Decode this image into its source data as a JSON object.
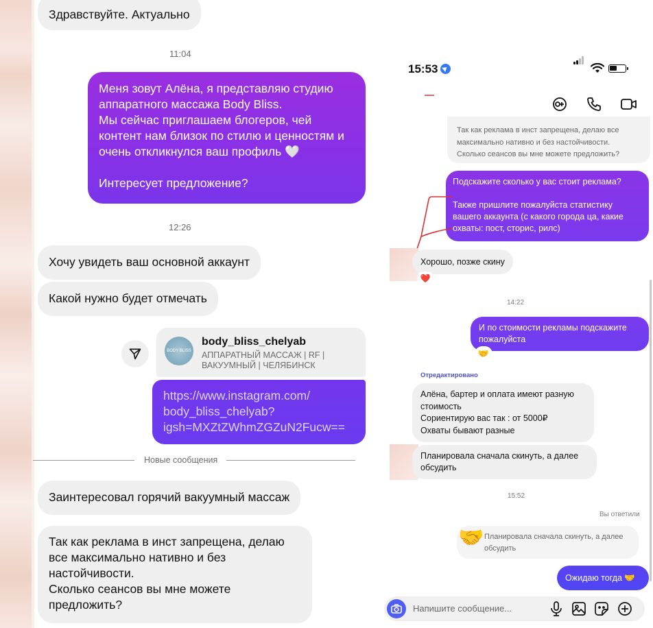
{
  "left": {
    "messages": [
      {
        "id": "m1",
        "direction": "in",
        "text": "Здравствуйте. Актуально"
      },
      {
        "id": "t1",
        "type": "time",
        "text": "11:04"
      },
      {
        "id": "m2",
        "direction": "out",
        "text": "Меня зовут Алёна, я представляю студию аппаратного массажа Body Bliss.\nМы сейчас приглашаем блогеров, чей контент нам близок по стилю и ценностям и очень откликнулся ваш профиль 🤍\n\nИнтересует предложение?"
      },
      {
        "id": "t2",
        "type": "time",
        "text": "12:26"
      },
      {
        "id": "m3",
        "direction": "in",
        "text": "Хочу увидеть ваш основной аккаунт"
      },
      {
        "id": "m4",
        "direction": "in",
        "text": "Какой нужно будет отмечать"
      },
      {
        "id": "m5",
        "direction": "in",
        "text": "Заинтересовал горячий вакуумный массаж"
      },
      {
        "id": "m6",
        "direction": "in",
        "text": "Так как реклама в инст запрещена, делаю все максимально нативно и без настойчивости.\nСколько сеансов вы мне можете предложить?"
      }
    ],
    "shared_profile": {
      "username": "body_bliss_chelyab",
      "description": "АППАРАТНЫЙ МАССАЖ | RF | ВАКУУМНЫЙ | ЧЕЛЯБИНСК",
      "avatar_text": "BODY BLISS"
    },
    "link_message": "https://www.instagram.com/\nbody_bliss_chelyab?\nigsh=MXZtZWhmZGZuN2Fucw==",
    "divider": "Новые сообщения"
  },
  "right": {
    "status_bar": {
      "time": "15:53"
    },
    "header_icons": [
      "video-chat-icon",
      "phone-icon",
      "video-camera-icon"
    ],
    "top_cut_message": "Так как реклама в инст запрещена, делаю все\nмаксимально нативно и без настойчивости.\nСколько сеансов вы мне можете предложить?",
    "msg_ask_price": "Подскажите сколько у вас стоит реклама?\n\nТакже пришлите пожалуйста статистику вашего аккаунта (с какого города ца, какие охваты: пост, сторис, рилс)",
    "msg_later": "Хорошо, позже скину",
    "heart": "❤️",
    "time1": "14:22",
    "msg_price_again": "И по стоимости рекламы подскажите пожалуйста",
    "reaction": "🤝",
    "edited": "Отредактировано",
    "msg_barter": "Алёна, бартер и оплата имеют разную стоимость\nСориентирую вас так : от 5000₽\nОхваты бывают разные",
    "msg_plan": "Планировала сначала скинуть, а далее обсудить",
    "time2": "15:52",
    "replied_label": "Вы ответили",
    "quoted_text": "Планировала сначала скинуть, а далее обсудить",
    "hand_emoji": "🤝",
    "msg_wait": "Ожидаю тогда 🤝",
    "input_placeholder": "Напишите сообщение..."
  }
}
